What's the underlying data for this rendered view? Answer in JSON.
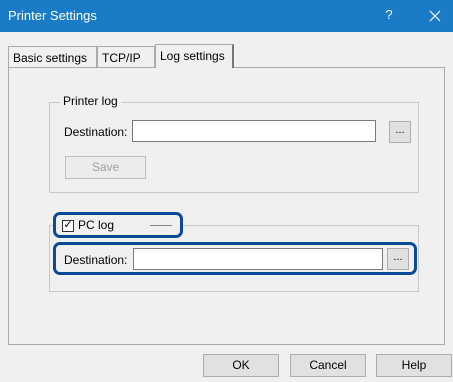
{
  "window": {
    "title": "Printer Settings",
    "help_glyph": "?",
    "close_glyph": "✕"
  },
  "tabs": [
    {
      "label": "Basic settings",
      "active": false
    },
    {
      "label": "TCP/IP",
      "active": false
    },
    {
      "label": "Log settings",
      "active": true
    }
  ],
  "printer_log": {
    "legend": "Printer log",
    "destination_label": "Destination:",
    "destination_value": "",
    "browse_label": "...",
    "save_label": "Save",
    "save_enabled": false
  },
  "pc_log": {
    "checkbox_label": "PC log",
    "checked": true,
    "check_glyph": "✓",
    "destination_label": "Destination:",
    "destination_value": "",
    "browse_label": "..."
  },
  "footer": {
    "ok_label": "OK",
    "cancel_label": "Cancel",
    "help_label": "Help"
  },
  "colors": {
    "titlebar": "#1a7cc6",
    "highlight": "#0b4a96"
  }
}
